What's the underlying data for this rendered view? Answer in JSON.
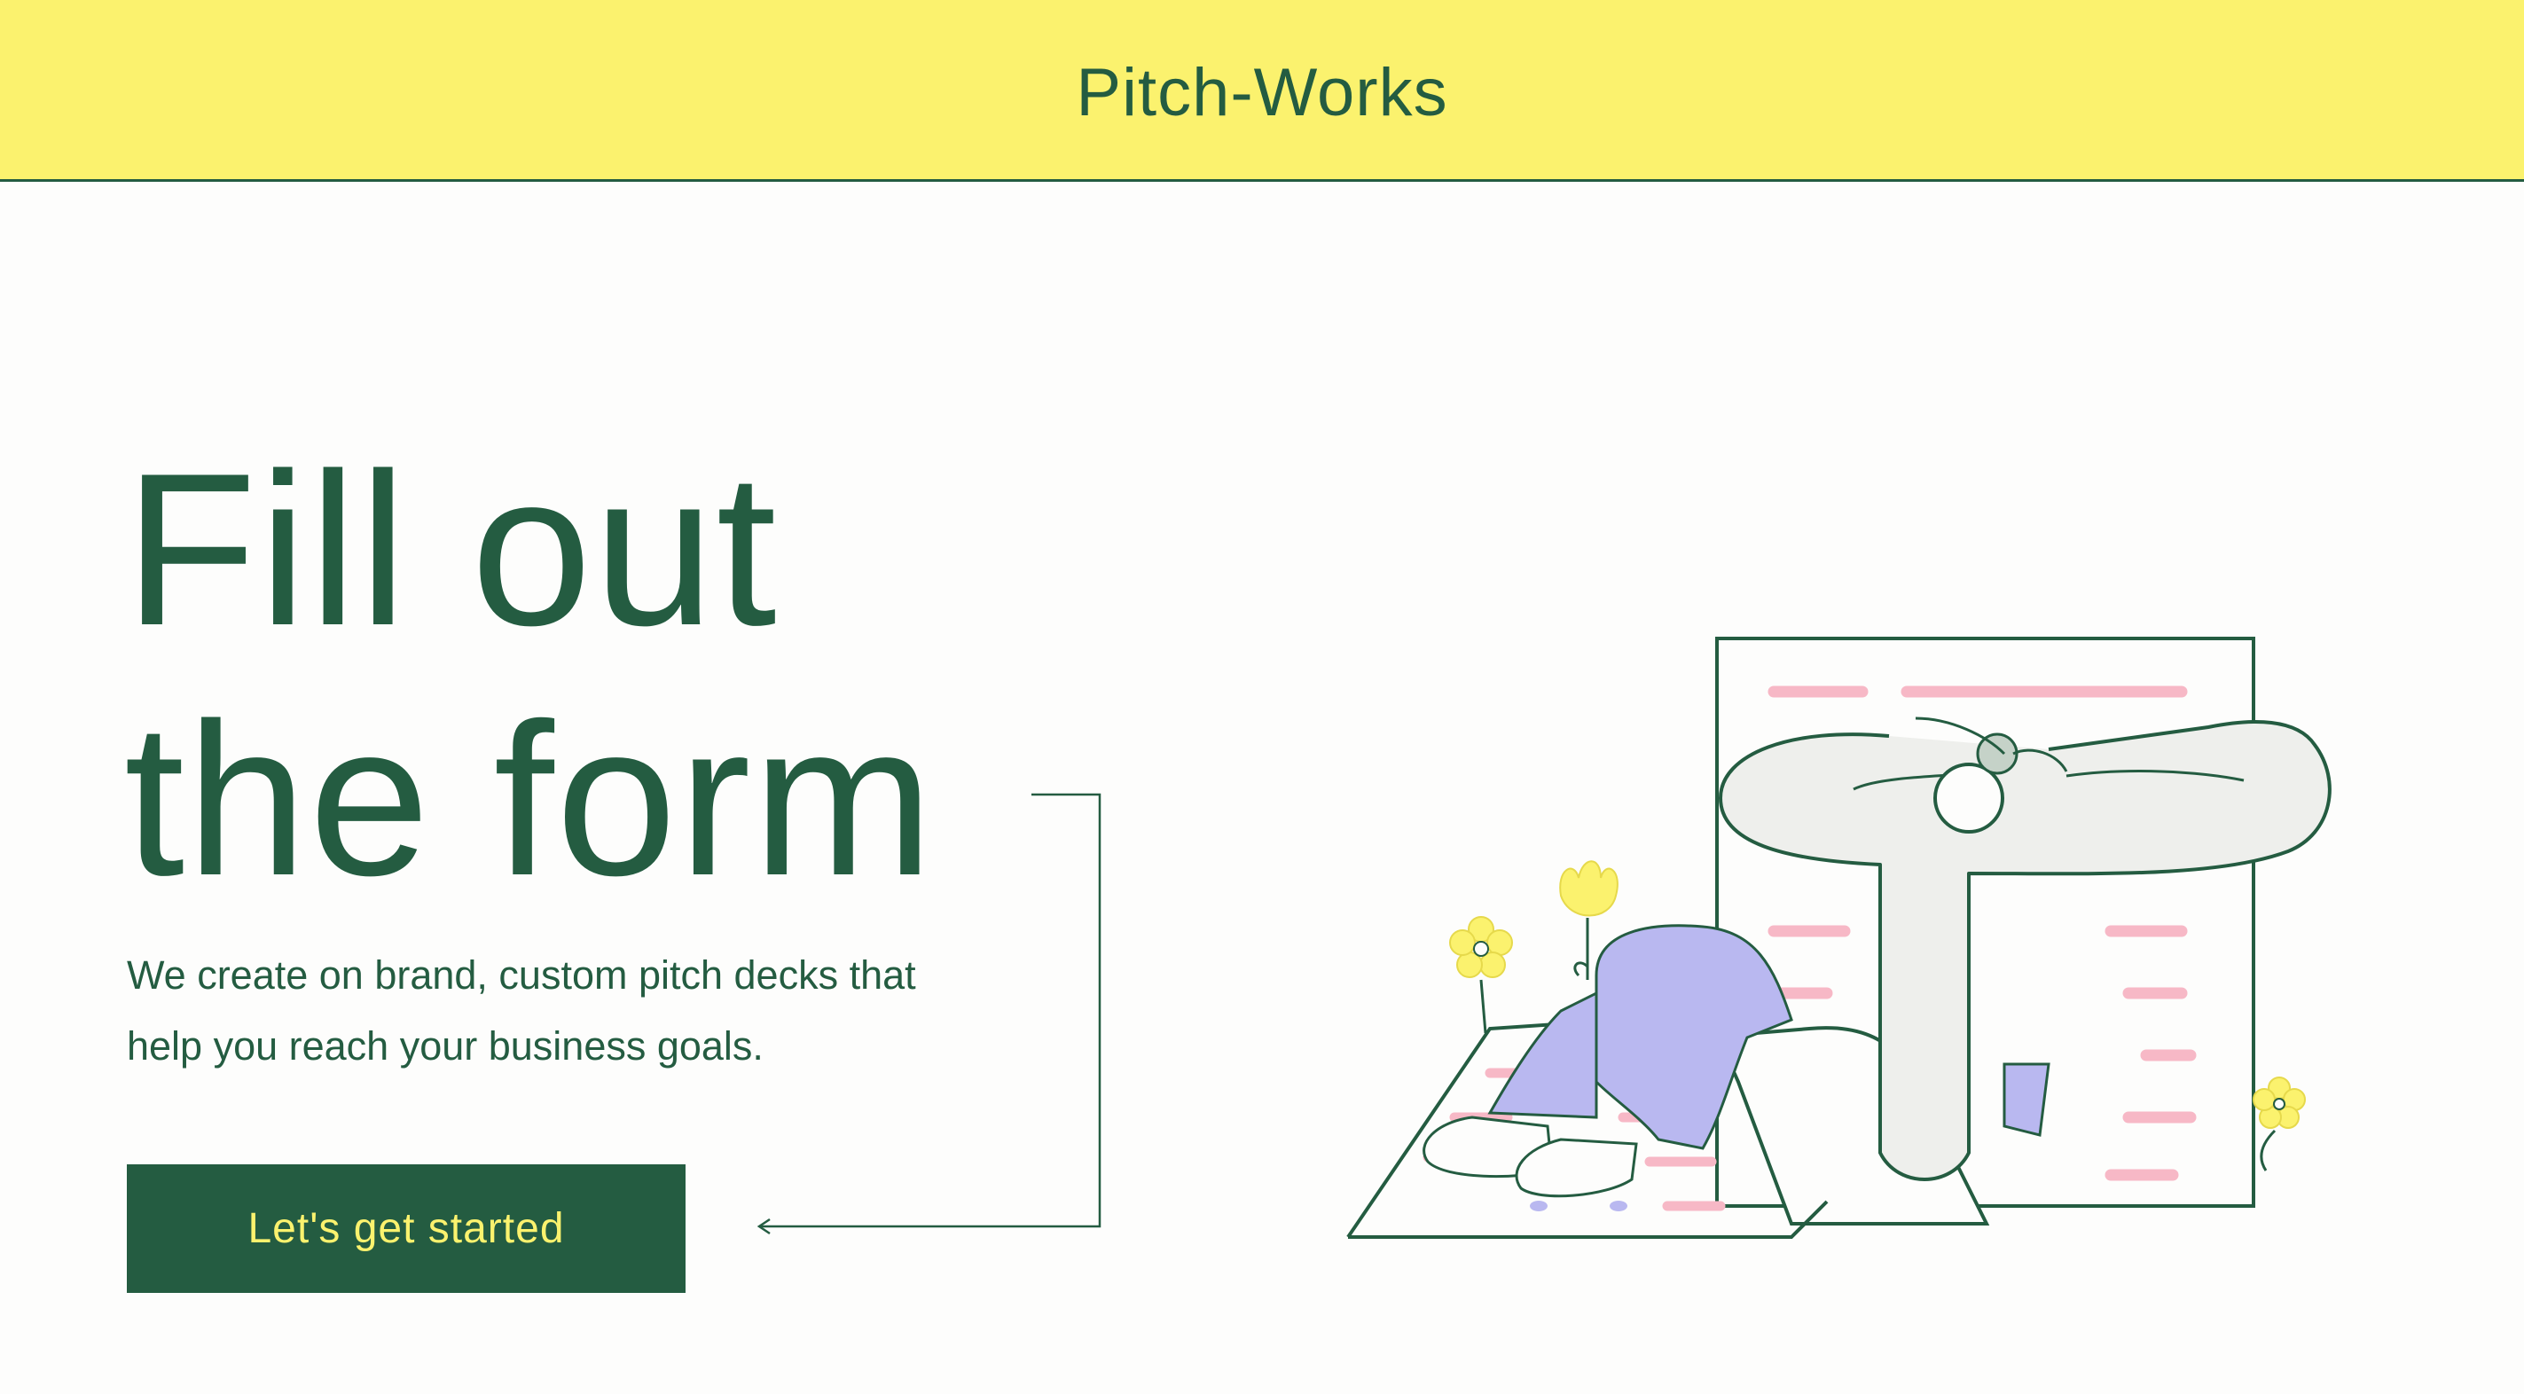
{
  "header": {
    "brand": "Pitch-Works",
    "background_color": "#fbf26e"
  },
  "hero": {
    "title_line1": "Fill out",
    "title_line2": "the form",
    "subtitle_line1": "We create on brand, custom pitch decks that",
    "subtitle_line2": "help you reach your business goals.",
    "cta_label": "Let's get started",
    "text_color": "#245c41",
    "cta_text_color": "#fbf26e"
  },
  "illustration": {
    "icon": "person-reading-document-illustration",
    "accent_colors": [
      "#b9b8f0",
      "#f7b8c6",
      "#fbf26e"
    ]
  }
}
